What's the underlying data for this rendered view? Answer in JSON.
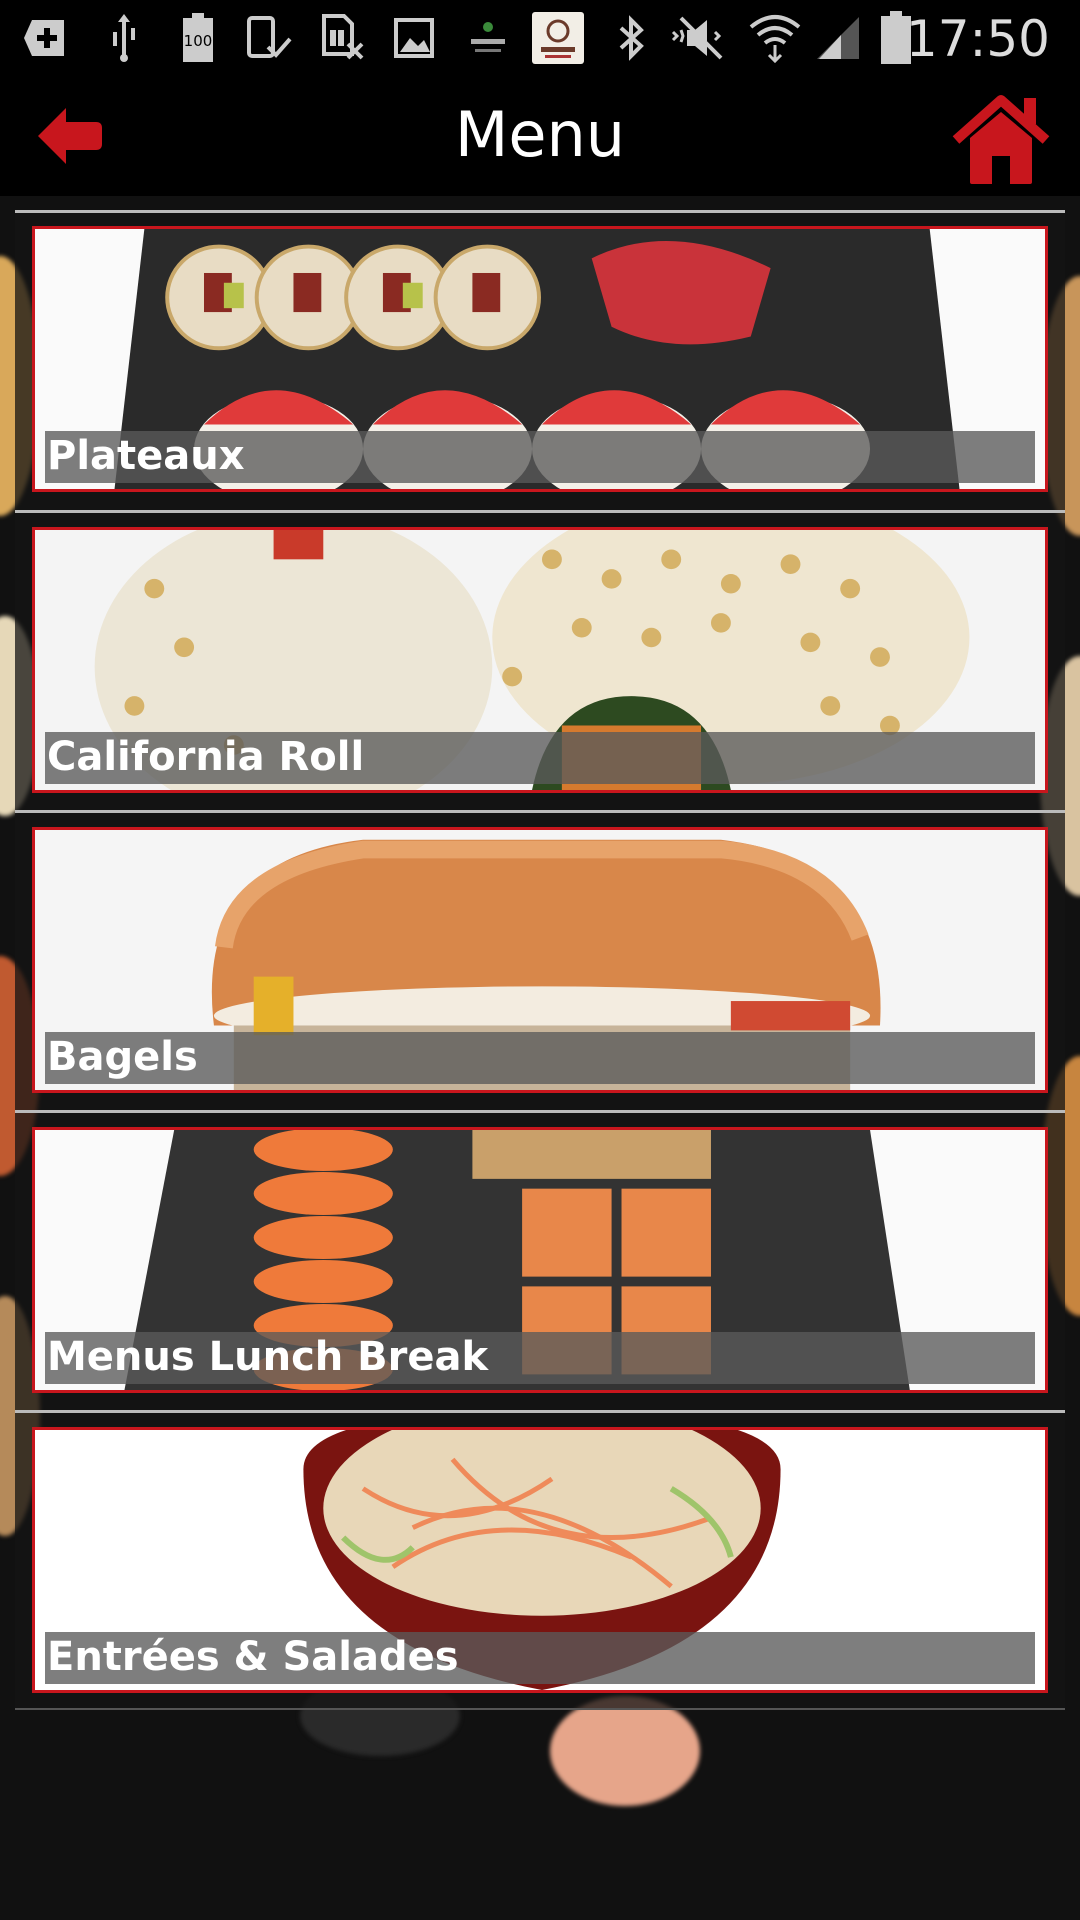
{
  "status_bar": {
    "time": "17:50",
    "battery_text": "100",
    "icons": [
      "add-box-icon",
      "usb-icon",
      "battery-icon",
      "tablet-check-icon",
      "sim-x-icon",
      "image-icon",
      "sortis-app-icon",
      "restaurant-app-icon",
      "bluetooth-icon",
      "mute-icon",
      "wifi-icon",
      "signal-icon",
      "battery-full-icon"
    ]
  },
  "app_bar": {
    "title": "Menu",
    "back_icon": "back-arrow-icon",
    "home_icon": "home-icon"
  },
  "menu": {
    "items": [
      {
        "label": "Plateaux"
      },
      {
        "label": "California Roll"
      },
      {
        "label": "Bagels"
      },
      {
        "label": "Menus Lunch Break"
      },
      {
        "label": "Entrées & Salades"
      }
    ]
  },
  "colors": {
    "accent": "#c8161d",
    "background": "#111111",
    "bar": "#000000"
  }
}
